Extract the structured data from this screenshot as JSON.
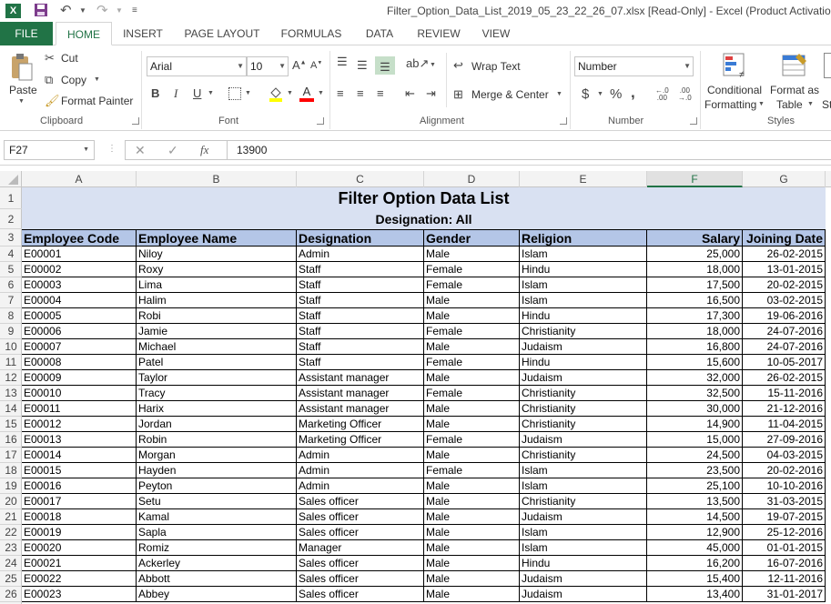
{
  "window": {
    "title": "Filter_Option_Data_List_2019_05_23_22_26_07.xlsx  [Read-Only] - Excel (Product Activation Fail"
  },
  "tabs": [
    "HOME",
    "INSERT",
    "PAGE LAYOUT",
    "FORMULAS",
    "DATA",
    "REVIEW",
    "VIEW"
  ],
  "file_tab": "FILE",
  "ribbon": {
    "clipboard": {
      "paste": "Paste",
      "cut": "Cut",
      "copy": "Copy",
      "format_painter": "Format Painter",
      "label": "Clipboard"
    },
    "font": {
      "name": "Arial",
      "size": "10",
      "bold": "B",
      "italic": "I",
      "underline": "U",
      "label": "Font"
    },
    "alignment": {
      "wrap_text": "Wrap Text",
      "merge_center": "Merge & Center",
      "label": "Alignment"
    },
    "number": {
      "format": "Number",
      "currency": "$",
      "percent": "%",
      "comma": ",",
      "label": "Number"
    },
    "styles": {
      "conditional_1": "Conditional",
      "conditional_2": "Formatting",
      "format_as_1": "Format as",
      "format_as_2": "Table",
      "cell_styles": "St",
      "label": "Styles"
    }
  },
  "formula_bar": {
    "name_box": "F27",
    "value": "13900",
    "fx": "fx"
  },
  "columns": [
    "A",
    "B",
    "C",
    "D",
    "E",
    "F",
    "G"
  ],
  "sheet": {
    "title": "Filter Option Data List",
    "subtitle": "Designation: All",
    "headers": [
      "Employee Code",
      "Employee Name",
      "Designation",
      "Gender",
      "Religion",
      "Salary",
      "Joining Date"
    ],
    "rows": [
      [
        "E00001",
        "Niloy",
        "Admin",
        "Male",
        "Islam",
        "25,000",
        "26-02-2015"
      ],
      [
        "E00002",
        "Roxy",
        "Staff",
        "Female",
        "Hindu",
        "18,000",
        "13-01-2015"
      ],
      [
        "E00003",
        "Lima",
        "Staff",
        "Female",
        "Islam",
        "17,500",
        "20-02-2015"
      ],
      [
        "E00004",
        "Halim",
        "Staff",
        "Male",
        "Islam",
        "16,500",
        "03-02-2015"
      ],
      [
        "E00005",
        "Robi",
        "Staff",
        "Male",
        "Hindu",
        "17,300",
        "19-06-2016"
      ],
      [
        "E00006",
        "Jamie",
        "Staff",
        "Female",
        "Christianity",
        "18,000",
        "24-07-2016"
      ],
      [
        "E00007",
        "Michael",
        "Staff",
        "Male",
        "Judaism",
        "16,800",
        "24-07-2016"
      ],
      [
        "E00008",
        "Patel",
        "Staff",
        "Female",
        "Hindu",
        "15,600",
        "10-05-2017"
      ],
      [
        "E00009",
        "Taylor",
        "Assistant manager",
        "Male",
        "Judaism",
        "32,000",
        "26-02-2015"
      ],
      [
        "E00010",
        "Tracy",
        "Assistant manager",
        "Female",
        "Christianity",
        "32,500",
        "15-11-2016"
      ],
      [
        "E00011",
        "Harix",
        "Assistant manager",
        "Male",
        "Christianity",
        "30,000",
        "21-12-2016"
      ],
      [
        "E00012",
        "Jordan",
        "Marketing Officer",
        "Male",
        "Christianity",
        "14,900",
        "11-04-2015"
      ],
      [
        "E00013",
        "Robin",
        "Marketing Officer",
        "Female",
        "Judaism",
        "15,000",
        "27-09-2016"
      ],
      [
        "E00014",
        "Morgan",
        "Admin",
        "Male",
        "Christianity",
        "24,500",
        "04-03-2015"
      ],
      [
        "E00015",
        "Hayden",
        "Admin",
        "Female",
        "Islam",
        "23,500",
        "20-02-2016"
      ],
      [
        "E00016",
        "Peyton",
        "Admin",
        "Male",
        "Islam",
        "25,100",
        "10-10-2016"
      ],
      [
        "E00017",
        "Setu",
        "Sales officer",
        "Male",
        "Christianity",
        "13,500",
        "31-03-2015"
      ],
      [
        "E00018",
        "Kamal",
        "Sales officer",
        "Male",
        "Judaism",
        "14,500",
        "19-07-2015"
      ],
      [
        "E00019",
        "Sapla",
        "Sales officer",
        "Male",
        "Islam",
        "12,900",
        "25-12-2016"
      ],
      [
        "E00020",
        "Romiz",
        "Manager",
        "Male",
        "Islam",
        "45,000",
        "01-01-2015"
      ],
      [
        "E00021",
        "Ackerley",
        "Sales officer",
        "Male",
        "Hindu",
        "16,200",
        "16-07-2016"
      ],
      [
        "E00022",
        "Abbott",
        "Sales officer",
        "Male",
        "Judaism",
        "15,400",
        "12-11-2016"
      ],
      [
        "E00023",
        "Abbey",
        "Sales officer",
        "Male",
        "Judaism",
        "13,400",
        "31-01-2017"
      ]
    ]
  }
}
